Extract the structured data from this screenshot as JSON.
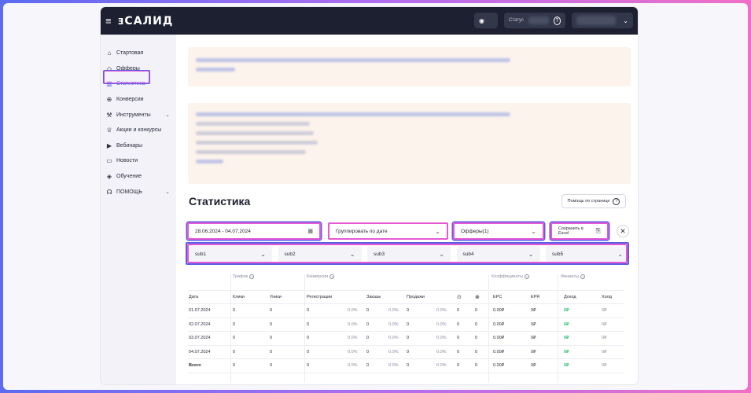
{
  "app": {
    "logo": "САЛИД",
    "menu_icon": "≡",
    "status_label": "Статус",
    "help_icon": "?"
  },
  "sidebar": {
    "items": [
      {
        "label": "Стартовая",
        "icon": "⌂",
        "icon_name": "home-icon"
      },
      {
        "label": "Офферы",
        "icon": "◇",
        "icon_name": "tag-icon"
      },
      {
        "label": "Статистика",
        "icon": "▥",
        "icon_name": "stats-icon",
        "active": true
      },
      {
        "label": "Конверсии",
        "icon": "⊕",
        "icon_name": "conversion-icon"
      },
      {
        "label": "Инструменты",
        "icon": "⚒",
        "icon_name": "tools-icon",
        "expandable": true
      },
      {
        "label": "Акции и конкурсы",
        "icon": "♕",
        "icon_name": "trophy-icon"
      },
      {
        "label": "Вебинары",
        "icon": "▶",
        "icon_name": "webinar-icon"
      },
      {
        "label": "Новости",
        "icon": "▭",
        "icon_name": "news-icon"
      },
      {
        "label": "Обучение",
        "icon": "◈",
        "icon_name": "education-icon"
      },
      {
        "label": "ПОМОЩЬ",
        "icon": "☊",
        "icon_name": "headset-icon",
        "expandable": true
      }
    ]
  },
  "page": {
    "title": "Статистика",
    "help_button": "Помощь по странице"
  },
  "filters": {
    "date_range": "28.06.2024 - 04.07.2024",
    "group_by": "Группировать по дате",
    "offers": "Офферы(1)",
    "export": "Сохранить в Excel",
    "subs": [
      "sub1",
      "sub2",
      "sub3",
      "sub4",
      "sub5"
    ]
  },
  "table": {
    "groups": {
      "traffic": "Трафик",
      "conversions": "Конверсии",
      "coefficients": "Коэффициенты",
      "finance": "Финансы"
    },
    "columns": [
      "Дата",
      "Клики",
      "Уники",
      "Регистрации",
      "Заказы",
      "Продажи",
      "EPC",
      "EPR",
      "Доход",
      "Холд"
    ],
    "rows": [
      {
        "date": "01.07.2024",
        "clicks": "0",
        "uniques": "0",
        "reg": "0",
        "reg_pct": "0.0%",
        "orders": "0",
        "orders_pct": "0.0%",
        "sales": "0",
        "sales_pct": "0.0%",
        "warn": "0",
        "err": "0",
        "epc": "0.00₽",
        "epr": "0₽",
        "income": "0₽",
        "hold": "0₽"
      },
      {
        "date": "02.07.2024",
        "clicks": "0",
        "uniques": "0",
        "reg": "0",
        "reg_pct": "0.0%",
        "orders": "0",
        "orders_pct": "0.0%",
        "sales": "0",
        "sales_pct": "0.0%",
        "warn": "0",
        "err": "0",
        "epc": "0.00₽",
        "epr": "0₽",
        "income": "0₽",
        "hold": "0₽"
      },
      {
        "date": "03.07.2024",
        "clicks": "0",
        "uniques": "0",
        "reg": "0",
        "reg_pct": "0.0%",
        "orders": "0",
        "orders_pct": "0.0%",
        "sales": "0",
        "sales_pct": "0.0%",
        "warn": "0",
        "err": "0",
        "epc": "0.00₽",
        "epr": "0₽",
        "income": "0₽",
        "hold": "0₽"
      },
      {
        "date": "04.07.2024",
        "clicks": "0",
        "uniques": "0",
        "reg": "0",
        "reg_pct": "0.0%",
        "orders": "0",
        "orders_pct": "0.0%",
        "sales": "0",
        "sales_pct": "0.0%",
        "warn": "0",
        "err": "0",
        "epc": "0.00₽",
        "epr": "0₽",
        "income": "0₽",
        "hold": "0₽"
      }
    ],
    "total": {
      "date": "Всего",
      "clicks": "0",
      "uniques": "0",
      "reg": "0",
      "reg_pct": "0.0%",
      "orders": "0",
      "orders_pct": "0.0%",
      "sales": "0",
      "sales_pct": "0.0%",
      "warn": "0",
      "err": "0",
      "epc": "0.00₽",
      "epr": "0₽",
      "income": "0₽",
      "hold": "0₽"
    }
  }
}
